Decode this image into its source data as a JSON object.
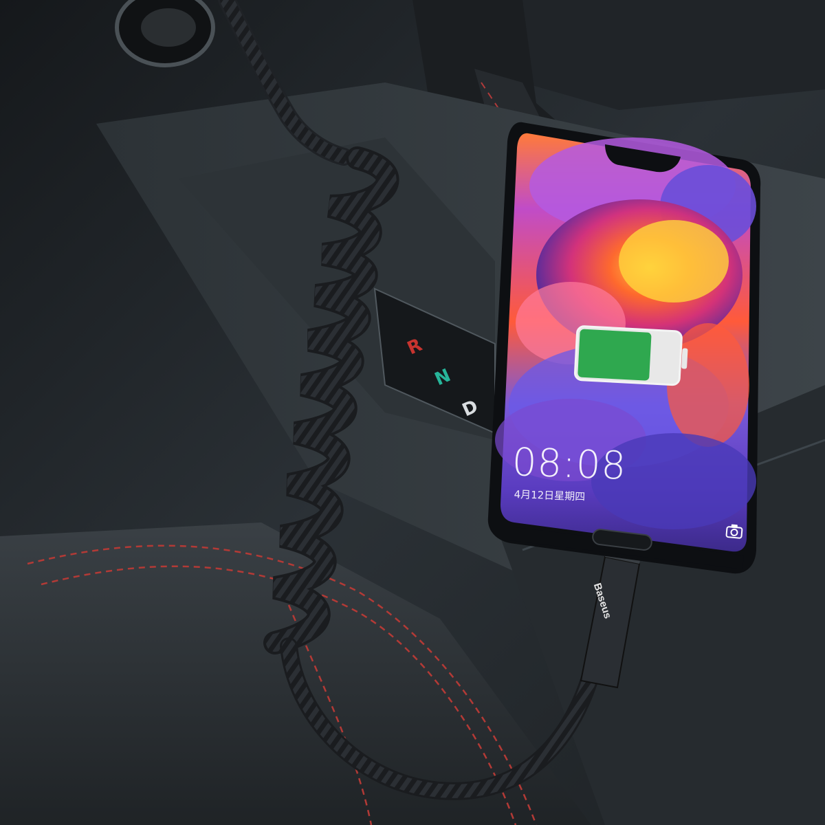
{
  "scene": {
    "description_icons": [
      "car-console",
      "coiled-charging-cable",
      "smartphone",
      "battery-icon",
      "camera-icon"
    ],
    "colors": {
      "interior": "#2a2f33",
      "stitching": "#c8342f",
      "battery_fill": "#2fa84f",
      "battery_empty": "#e8e8e8"
    }
  },
  "phone": {
    "clock": "08:08",
    "date": "4月12日星期四",
    "battery_level": 0.72
  },
  "console": {
    "gear_r": "R",
    "gear_n": "N",
    "gear_d": "D"
  },
  "cable": {
    "brand": "Baseus"
  }
}
